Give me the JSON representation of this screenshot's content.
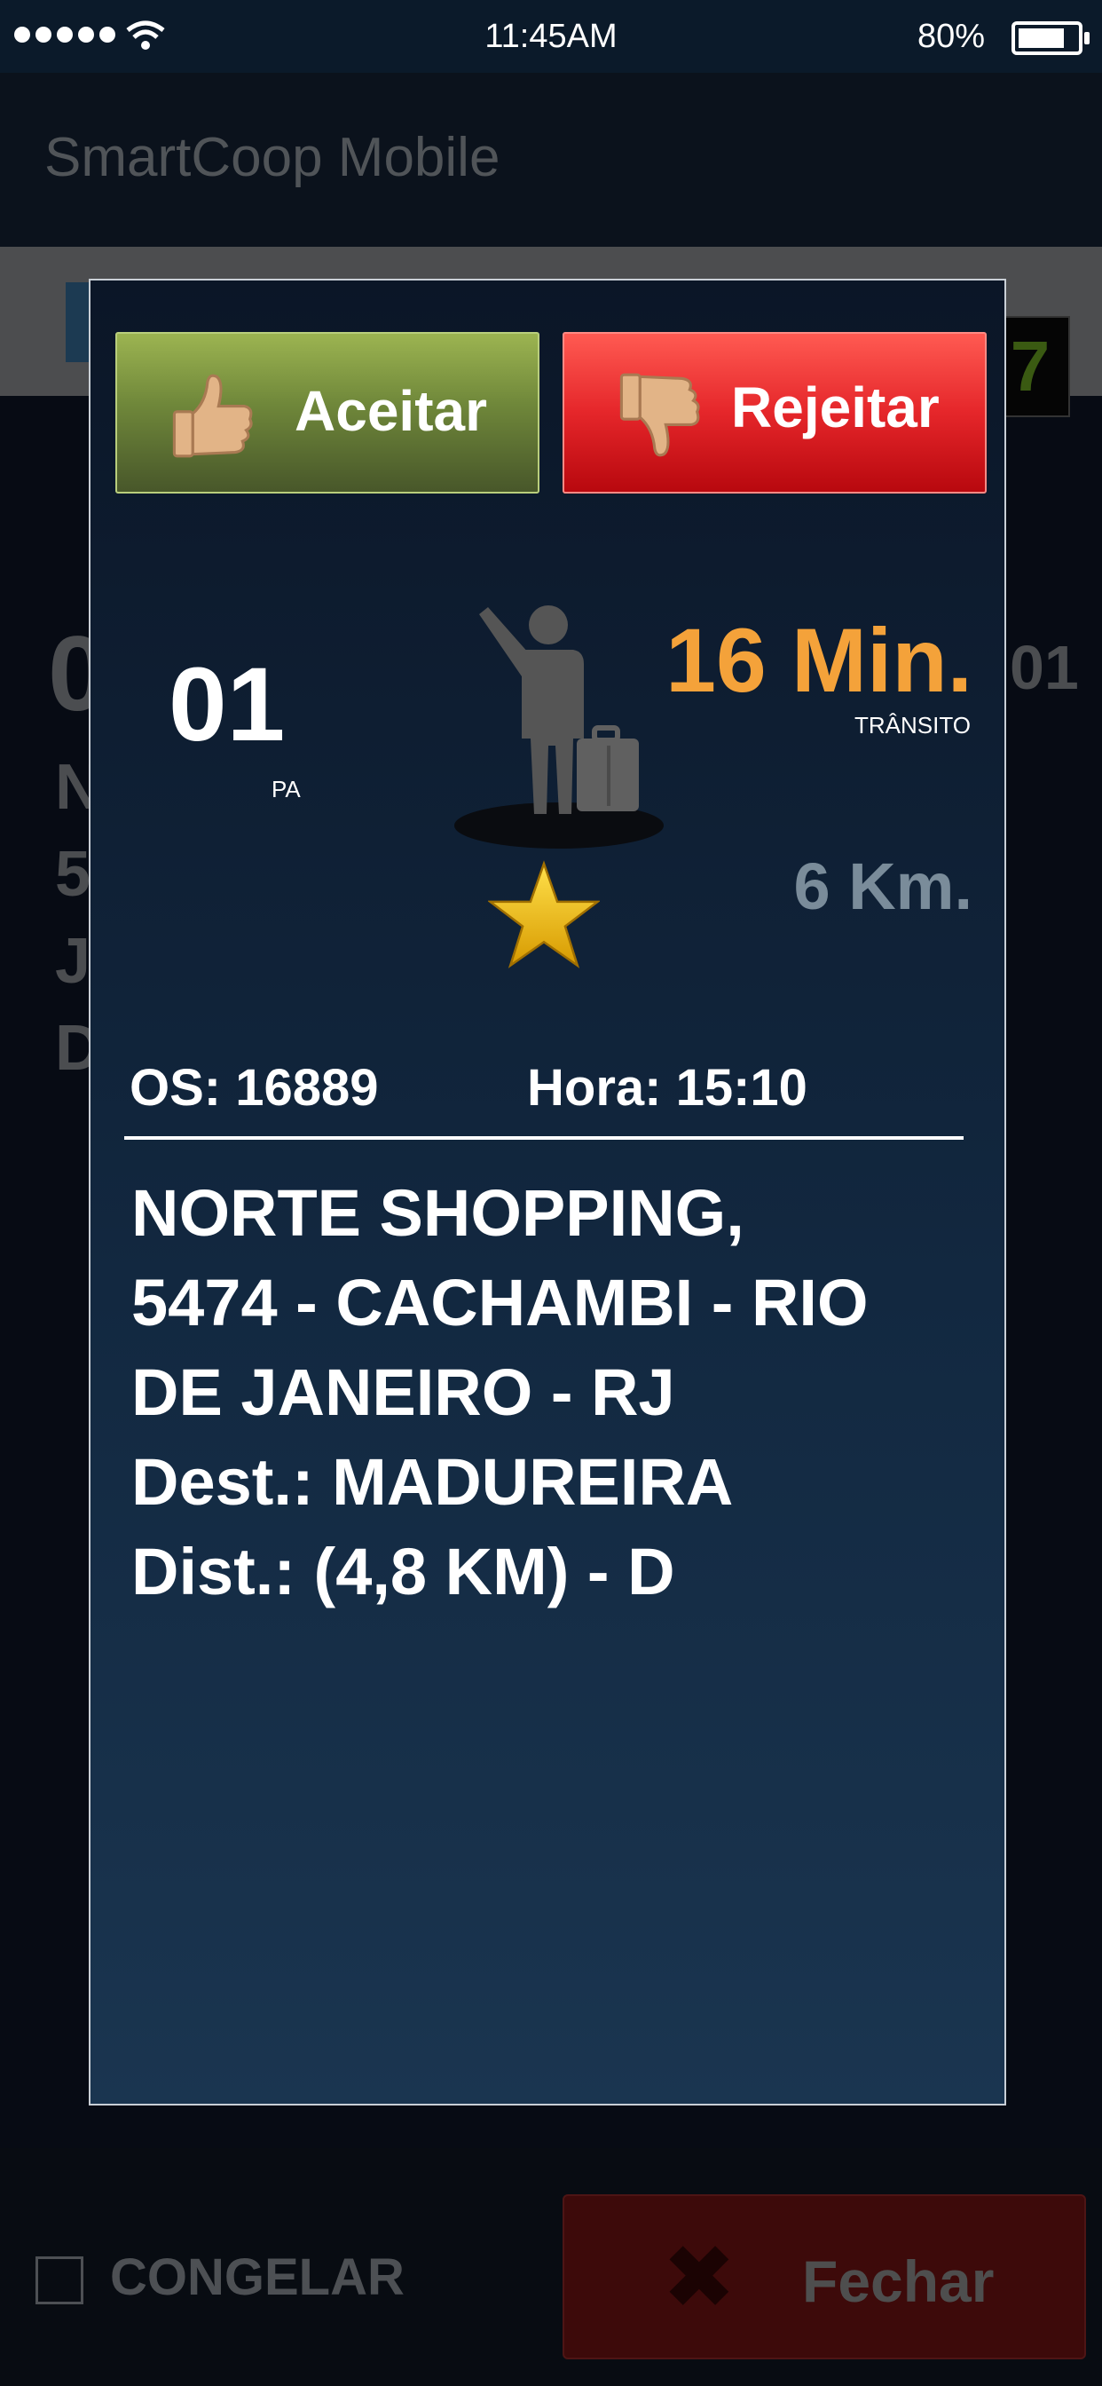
{
  "status_bar": {
    "time": "11:45AM",
    "battery_percent": "80%",
    "battery_level": 0.8
  },
  "app": {
    "title": "SmartCoop Mobile",
    "counter_digit": "7"
  },
  "background_partial": {
    "left_big": "0",
    "right_small": "01",
    "left_letters": [
      "N",
      "5",
      "J",
      "D"
    ]
  },
  "bottom": {
    "freeze_label": "CONGELAR",
    "close_label": "Fechar"
  },
  "modal": {
    "accept_label": "Aceitar",
    "reject_label": "Rejeitar",
    "pa_number": "01",
    "pa_label": "PA",
    "time_value": "16 Min.",
    "traffic_label": "TRÂNSITO",
    "distance": "6 Km.",
    "os": "OS: 16889",
    "hour": "Hora: 15:10",
    "address_lines": [
      "NORTE SHOPPING,",
      "5474 - CACHAMBI - RIO",
      "DE JANEIRO - RJ",
      "Dest.: MADUREIRA",
      "Dist.: (4,8 KM) - D"
    ]
  },
  "colors": {
    "time_accent": "#f4a23a",
    "accept": "#6f873a",
    "reject": "#e5262a"
  }
}
